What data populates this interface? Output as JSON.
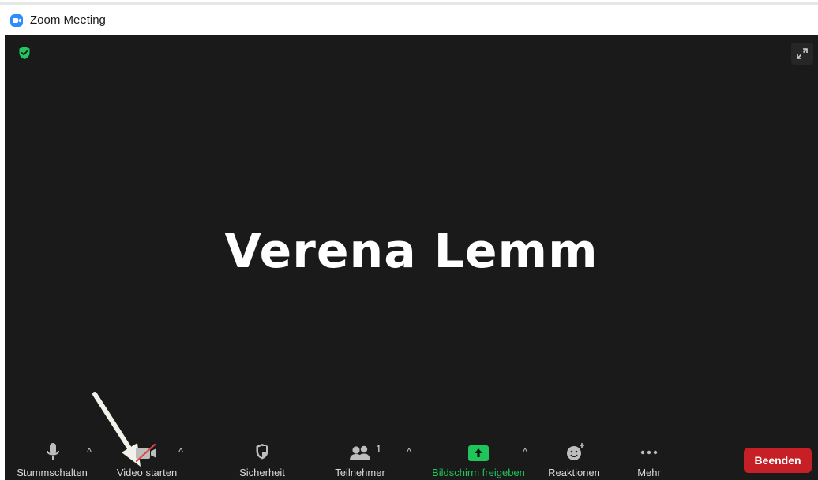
{
  "window": {
    "title": "Zoom Meeting"
  },
  "stage": {
    "participant_name": "Verena Lemm"
  },
  "toolbar": {
    "mute_label": "Stummschalten",
    "video_label": "Video starten",
    "security_label": "Sicherheit",
    "participants_label": "Teilnehmer",
    "participants_count": "1",
    "share_label": "Bildschirm freigeben",
    "reactions_label": "Reaktionen",
    "more_label": "Mehr",
    "end_label": "Beenden"
  },
  "colors": {
    "share_green": "#1fc45a",
    "end_red": "#c71f26",
    "stage_bg": "#1a1a1a"
  }
}
